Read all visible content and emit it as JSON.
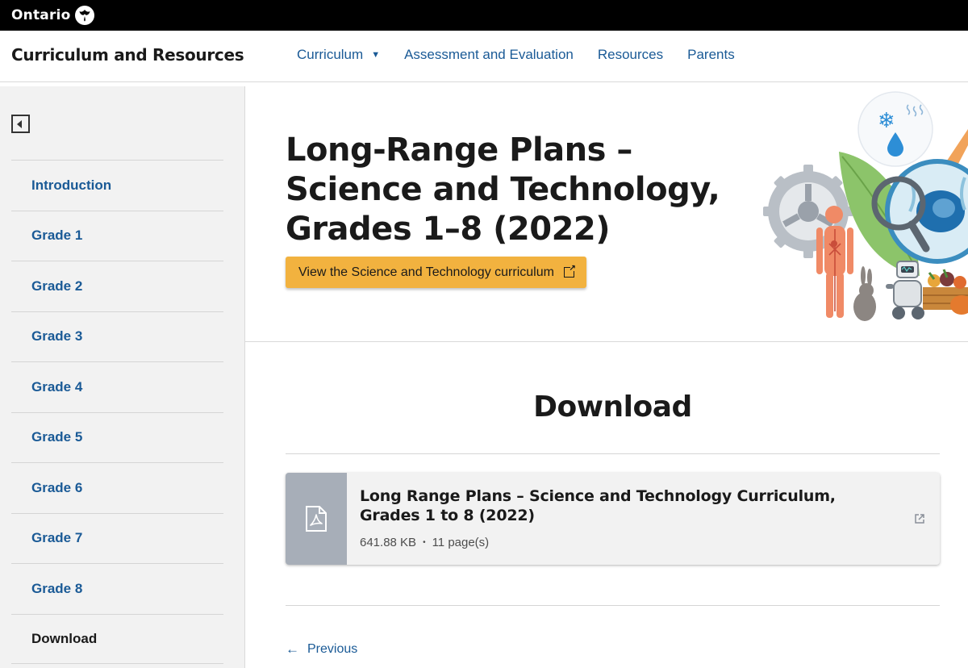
{
  "gov_bar": {
    "brand": "Ontario",
    "logo_icon": "trillium-icon"
  },
  "header": {
    "site_title": "Curriculum and Resources",
    "nav": [
      {
        "label": "Curriculum",
        "has_dropdown": true
      },
      {
        "label": "Assessment and Evaluation"
      },
      {
        "label": "Resources"
      },
      {
        "label": "Parents"
      }
    ]
  },
  "sidebar": {
    "collapse_icon": "collapse-sidebar-icon",
    "items": [
      {
        "label": "Introduction"
      },
      {
        "label": "Grade 1"
      },
      {
        "label": "Grade 2"
      },
      {
        "label": "Grade 3"
      },
      {
        "label": "Grade 4"
      },
      {
        "label": "Grade 5"
      },
      {
        "label": "Grade 6"
      },
      {
        "label": "Grade 7"
      },
      {
        "label": "Grade 8"
      },
      {
        "label": "Download",
        "active": true
      }
    ]
  },
  "hero": {
    "title": "Long-Range Plans – Science and Technology, Grades 1–8 (2022)",
    "button_label": "View the Science and Technology curriculum"
  },
  "download": {
    "heading": "Download",
    "file": {
      "title": "Long Range Plans – Science and Technology Curriculum, Grades 1 to 8 (2022)",
      "size": "641.88 KB",
      "separator": "•",
      "pages": "11 page(s)",
      "icon": "pdf-file-icon"
    }
  },
  "pagination": {
    "previous_label": "Previous"
  },
  "colors": {
    "link": "#1a5a96",
    "cta": "#f2b23f",
    "gov_bar": "#000000",
    "sidebar_bg": "#f2f2f2",
    "file_icon_bg": "#a7aeb8"
  }
}
